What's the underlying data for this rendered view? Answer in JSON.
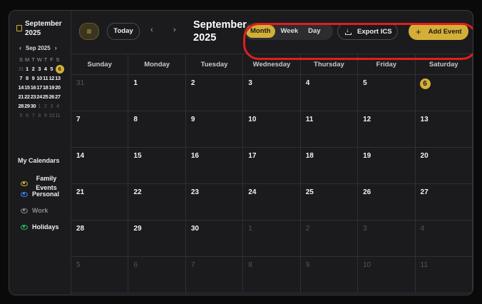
{
  "sidebar": {
    "title": "September 2025",
    "mini_month": "Sep 2025",
    "prev": "‹",
    "next": "›",
    "dow": [
      "S",
      "M",
      "T",
      "W",
      "T",
      "F",
      "S"
    ],
    "weeks": [
      [
        {
          "d": "31",
          "m": true
        },
        {
          "d": "1"
        },
        {
          "d": "2"
        },
        {
          "d": "3"
        },
        {
          "d": "4"
        },
        {
          "d": "5"
        },
        {
          "d": "6",
          "today": true
        }
      ],
      [
        {
          "d": "7"
        },
        {
          "d": "8"
        },
        {
          "d": "9"
        },
        {
          "d": "10"
        },
        {
          "d": "11"
        },
        {
          "d": "12"
        },
        {
          "d": "13"
        }
      ],
      [
        {
          "d": "14"
        },
        {
          "d": "15"
        },
        {
          "d": "16"
        },
        {
          "d": "17"
        },
        {
          "d": "18"
        },
        {
          "d": "19"
        },
        {
          "d": "20"
        }
      ],
      [
        {
          "d": "21"
        },
        {
          "d": "22"
        },
        {
          "d": "23"
        },
        {
          "d": "24"
        },
        {
          "d": "25"
        },
        {
          "d": "26"
        },
        {
          "d": "27"
        }
      ],
      [
        {
          "d": "28"
        },
        {
          "d": "29"
        },
        {
          "d": "30"
        },
        {
          "d": "1",
          "m": true
        },
        {
          "d": "2",
          "m": true
        },
        {
          "d": "3",
          "m": true
        },
        {
          "d": "4",
          "m": true
        }
      ],
      [
        {
          "d": "5",
          "m": true
        },
        {
          "d": "6",
          "m": true
        },
        {
          "d": "7",
          "m": true
        },
        {
          "d": "8",
          "m": true
        },
        {
          "d": "9",
          "m": true
        },
        {
          "d": "10",
          "m": true
        },
        {
          "d": "11",
          "m": true
        }
      ]
    ],
    "my_calendars_label": "My Calendars",
    "calendars": [
      {
        "name": "Family Events",
        "color": "#d4af37",
        "visible": true
      },
      {
        "name": "Personal",
        "color": "#3b82f6",
        "visible": true
      },
      {
        "name": "Work",
        "color": "#8a8a90",
        "visible": false
      },
      {
        "name": "Holidays",
        "color": "#22c55e",
        "visible": true
      }
    ]
  },
  "header": {
    "today_label": "Today",
    "prev": "‹",
    "next": "›",
    "title": "September 2025",
    "views": [
      {
        "label": "Month",
        "active": true
      },
      {
        "label": "Week",
        "active": false
      },
      {
        "label": "Day",
        "active": false
      }
    ],
    "export_label": "Export ICS",
    "add_label": "Add Event"
  },
  "calendar": {
    "dow": [
      "Sunday",
      "Monday",
      "Tuesday",
      "Wednesday",
      "Thursday",
      "Friday",
      "Saturday"
    ],
    "weeks": [
      [
        {
          "d": "31",
          "m": true
        },
        {
          "d": "1"
        },
        {
          "d": "2"
        },
        {
          "d": "3"
        },
        {
          "d": "4"
        },
        {
          "d": "5"
        },
        {
          "d": "6",
          "today": true
        }
      ],
      [
        {
          "d": "7"
        },
        {
          "d": "8"
        },
        {
          "d": "9"
        },
        {
          "d": "10"
        },
        {
          "d": "11"
        },
        {
          "d": "12"
        },
        {
          "d": "13"
        }
      ],
      [
        {
          "d": "14"
        },
        {
          "d": "15"
        },
        {
          "d": "16"
        },
        {
          "d": "17"
        },
        {
          "d": "18"
        },
        {
          "d": "19"
        },
        {
          "d": "20"
        }
      ],
      [
        {
          "d": "21"
        },
        {
          "d": "22"
        },
        {
          "d": "23"
        },
        {
          "d": "24"
        },
        {
          "d": "25"
        },
        {
          "d": "26"
        },
        {
          "d": "27"
        }
      ],
      [
        {
          "d": "28"
        },
        {
          "d": "29"
        },
        {
          "d": "30"
        },
        {
          "d": "1",
          "m": true
        },
        {
          "d": "2",
          "m": true
        },
        {
          "d": "3",
          "m": true
        },
        {
          "d": "4",
          "m": true
        }
      ],
      [
        {
          "d": "5",
          "m": true
        },
        {
          "d": "6",
          "m": true
        },
        {
          "d": "7",
          "m": true
        },
        {
          "d": "8",
          "m": true
        },
        {
          "d": "9",
          "m": true
        },
        {
          "d": "10",
          "m": true
        },
        {
          "d": "11",
          "m": true
        }
      ]
    ]
  },
  "colors": {
    "accent": "#d4af37",
    "annotation": "#e01e1e"
  }
}
